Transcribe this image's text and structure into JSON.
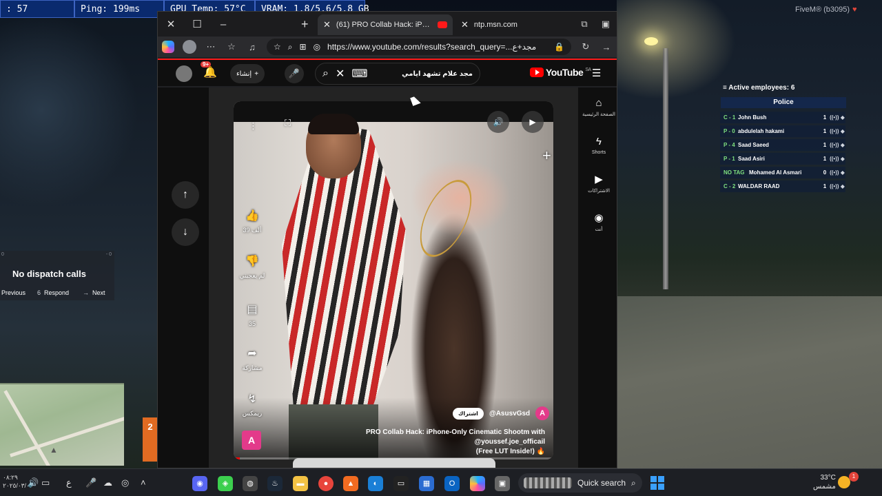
{
  "hud": {
    "fps": ": 57",
    "ping": "Ping: 199ms",
    "gpu_temp": "GPU Temp: 57°C",
    "vram": "VRAM: 1.8/5.6/5.8 GB"
  },
  "fivem_tag": "FiveM® (b3095)",
  "employees": {
    "title": "Active employees: 6",
    "department": "Police",
    "rows": [
      {
        "callsign": "C - 1",
        "name": "John Bush",
        "status": "1"
      },
      {
        "callsign": "P - 0",
        "name": "abdulelah hakami",
        "status": "1"
      },
      {
        "callsign": "P - 4",
        "name": "Saad Saeed",
        "status": "1"
      },
      {
        "callsign": "P - 1",
        "name": "Saad Asiri",
        "status": "1"
      },
      {
        "callsign": "NO TAG",
        "name": "Mohamed Al Asmari",
        "status": "0"
      },
      {
        "callsign": "C - 2",
        "name": "WALDAR RAAD",
        "status": "1"
      }
    ]
  },
  "dispatch": {
    "corner_left": "0",
    "corner_right": "- 0",
    "message": "No dispatch calls",
    "previous": "Previous",
    "respond_key": "6",
    "respond": "Respond",
    "next": "Next"
  },
  "gear": "2",
  "browser": {
    "active_tab_title": "(61) PRO Collab Hack: iPhone-Onl",
    "other_tab_title": "ntp.msn.com",
    "url": "https://www.youtube.com/results?search_query=...مجد+ع"
  },
  "youtube": {
    "notification_count": "9+",
    "create_label": "إنشاء",
    "search_query": "مجد علام تشهد ايامي",
    "logo_text": "YouTube",
    "region": "SA",
    "side_nav": [
      {
        "label": "الصفحة الرئيسية",
        "icon": "home-icon"
      },
      {
        "label": "Shorts",
        "icon": "shorts-icon"
      },
      {
        "label": "الاشتراكات",
        "icon": "subscriptions-icon"
      },
      {
        "label": "أنت",
        "icon": "you-icon"
      }
    ],
    "short": {
      "like_label": "39 ألف",
      "dislike_label": "لم يعجبني",
      "comments_count": "35",
      "share_label": "مشاركة",
      "remix_label": "ريمكس",
      "channel": "@AsusvGsd",
      "subscribe_label": "اشتراك",
      "channel_avatar_letter": "A",
      "title_line1": "PRO Collab Hack: iPhone-Only Cinematic Shootm with @youssef.joe_officail",
      "title_line2": "(Free LUT Inside!) 🔥",
      "progress_pct": 2
    }
  },
  "taskbar": {
    "time": "٠٨:٢٩",
    "date": "٢٠٢٥/٠٣/٠٣",
    "language": "ع",
    "search_label": "Quick search",
    "temperature": "33°C",
    "weather": "مشمس",
    "weather_badge": "1"
  },
  "colors": {
    "hud_bg": "#0a2a6e",
    "youtube_red": "#ff0000",
    "callsign_green": "#7fe07f"
  }
}
